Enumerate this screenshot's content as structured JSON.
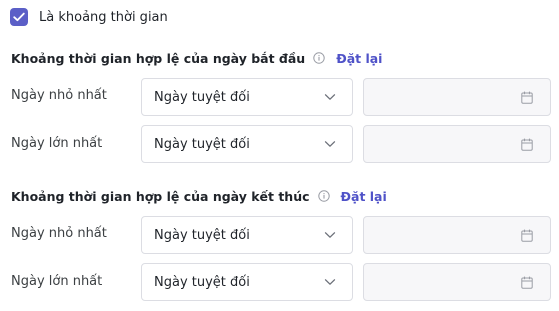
{
  "period_checkbox": {
    "checked": true,
    "label": "Là khoảng thời gian"
  },
  "sections": [
    {
      "title": "Khoảng thời gian hợp lệ của ngày bắt đầu",
      "reset_label": "Đặt lại",
      "rows": [
        {
          "label": "Ngày nhỏ nhất",
          "select_value": "Ngày tuyệt đối",
          "date_value": ""
        },
        {
          "label": "Ngày lớn nhất",
          "select_value": "Ngày tuyệt đối",
          "date_value": ""
        }
      ]
    },
    {
      "title": "Khoảng thời gian hợp lệ của ngày kết thúc",
      "reset_label": "Đặt lại",
      "rows": [
        {
          "label": "Ngày nhỏ nhất",
          "select_value": "Ngày tuyệt đối",
          "date_value": ""
        },
        {
          "label": "Ngày lớn nhất",
          "select_value": "Ngày tuyệt đối",
          "date_value": ""
        }
      ]
    }
  ],
  "colors": {
    "accent": "#5b5fc7",
    "link": "#4f52c8",
    "border": "#dcdde3",
    "input_bg": "#f7f7f9"
  },
  "icons": {
    "checkbox": "check-icon",
    "info": "info-icon",
    "dropdown": "chevron-down-icon",
    "date": "calendar-icon"
  }
}
